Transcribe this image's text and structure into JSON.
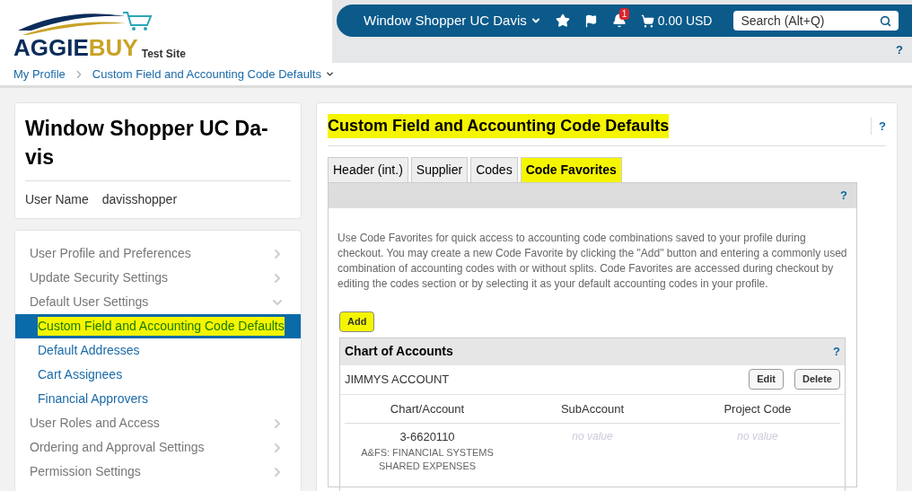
{
  "header": {
    "logo_text_1": "AGGIE",
    "logo_text_2": "BUY",
    "logo_sub": "Test Site",
    "user_menu": "Window Shopper UC Davis",
    "notification_count": "1",
    "cart_total": "0.00 USD",
    "search": {
      "placeholder": "Search (Alt+Q)"
    },
    "help": "?"
  },
  "breadcrumb": [
    "My Profile",
    "Custom Field and Accounting Code Defaults"
  ],
  "profile_card": {
    "name": "Window Shopper UC Da-vis",
    "user_name_label": "User Name",
    "user_name": "davisshopper"
  },
  "nav": [
    {
      "label": "User Profile and Preferences",
      "expanded": false,
      "selected": false
    },
    {
      "label": "Update Security Settings",
      "expanded": false,
      "selected": false
    },
    {
      "label": "Default User Settings",
      "expanded": true,
      "selected": false,
      "children": [
        {
          "label": "Custom Field and Accounting Code Defaults",
          "selected": true,
          "highlighted": true
        },
        {
          "label": "Default Addresses",
          "selected": false,
          "highlighted": false
        },
        {
          "label": "Cart Assignees",
          "selected": false,
          "highlighted": false
        },
        {
          "label": "Financial Approvers",
          "selected": false,
          "highlighted": false
        }
      ]
    },
    {
      "label": "User Roles and Access",
      "expanded": false,
      "selected": false
    },
    {
      "label": "Ordering and Approval Settings",
      "expanded": false,
      "selected": false
    },
    {
      "label": "Permission Settings",
      "expanded": false,
      "selected": false
    }
  ],
  "main": {
    "title": "Custom Field and Accounting Code Defaults",
    "title_highlighted": true,
    "help": "?",
    "tabs": [
      {
        "label": "Header (int.)",
        "selected": false,
        "highlighted": false
      },
      {
        "label": "Supplier",
        "selected": false,
        "highlighted": false
      },
      {
        "label": "Codes",
        "selected": false,
        "highlighted": false
      },
      {
        "label": "Code Favorites",
        "selected": true,
        "highlighted": true
      }
    ],
    "panel_help": "?",
    "description": "Use Code Favorites for quick access to accounting code combinations saved to your profile during checkout. You may create a new Code Favorite by clicking the \"Add\" button and entering a commonly used combination of accounting codes with or without splits. Code Favorites are accessed during checkout by editing the codes section or by selecting it as your default accounting codes in your profile.",
    "add_button": {
      "label": "Add",
      "highlighted": true
    },
    "chart_of_accounts": {
      "title": "Chart of Accounts",
      "help": "?",
      "favorite_name": "JIMMYS ACCOUNT",
      "edit": "Edit",
      "delete": "Delete",
      "columns": [
        "Chart/Account",
        "SubAccount",
        "Project Code"
      ],
      "row": {
        "account": "3-6620110",
        "account_desc": "A&FS: FINANCIAL SYSTEMS SHARED EXPENSES",
        "subaccount": "no value",
        "project_code": "no value"
      }
    }
  }
}
